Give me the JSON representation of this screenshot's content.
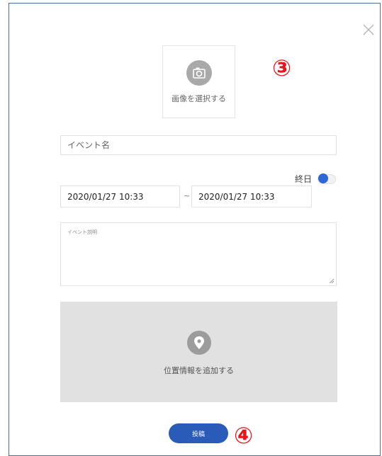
{
  "image_picker": {
    "label": "画像を選択する",
    "icon": "camera-icon"
  },
  "markers": {
    "step3": "③",
    "step4": "④"
  },
  "event_name": {
    "placeholder": "イベント名"
  },
  "all_day": {
    "label": "終日",
    "enabled": true
  },
  "date_range": {
    "start": "2020/01/27 10:33",
    "separator": "~",
    "end": "2020/01/27 10:33"
  },
  "description": {
    "placeholder": "イベント説明"
  },
  "location": {
    "label": "位置情報を追加する",
    "icon": "map-pin-icon"
  },
  "submit": {
    "label": "投稿"
  },
  "colors": {
    "accent": "#2b5bb8",
    "toggle_on": "#2e66d6",
    "marker": "#e8141b",
    "location_bg": "#e1e1e1"
  }
}
